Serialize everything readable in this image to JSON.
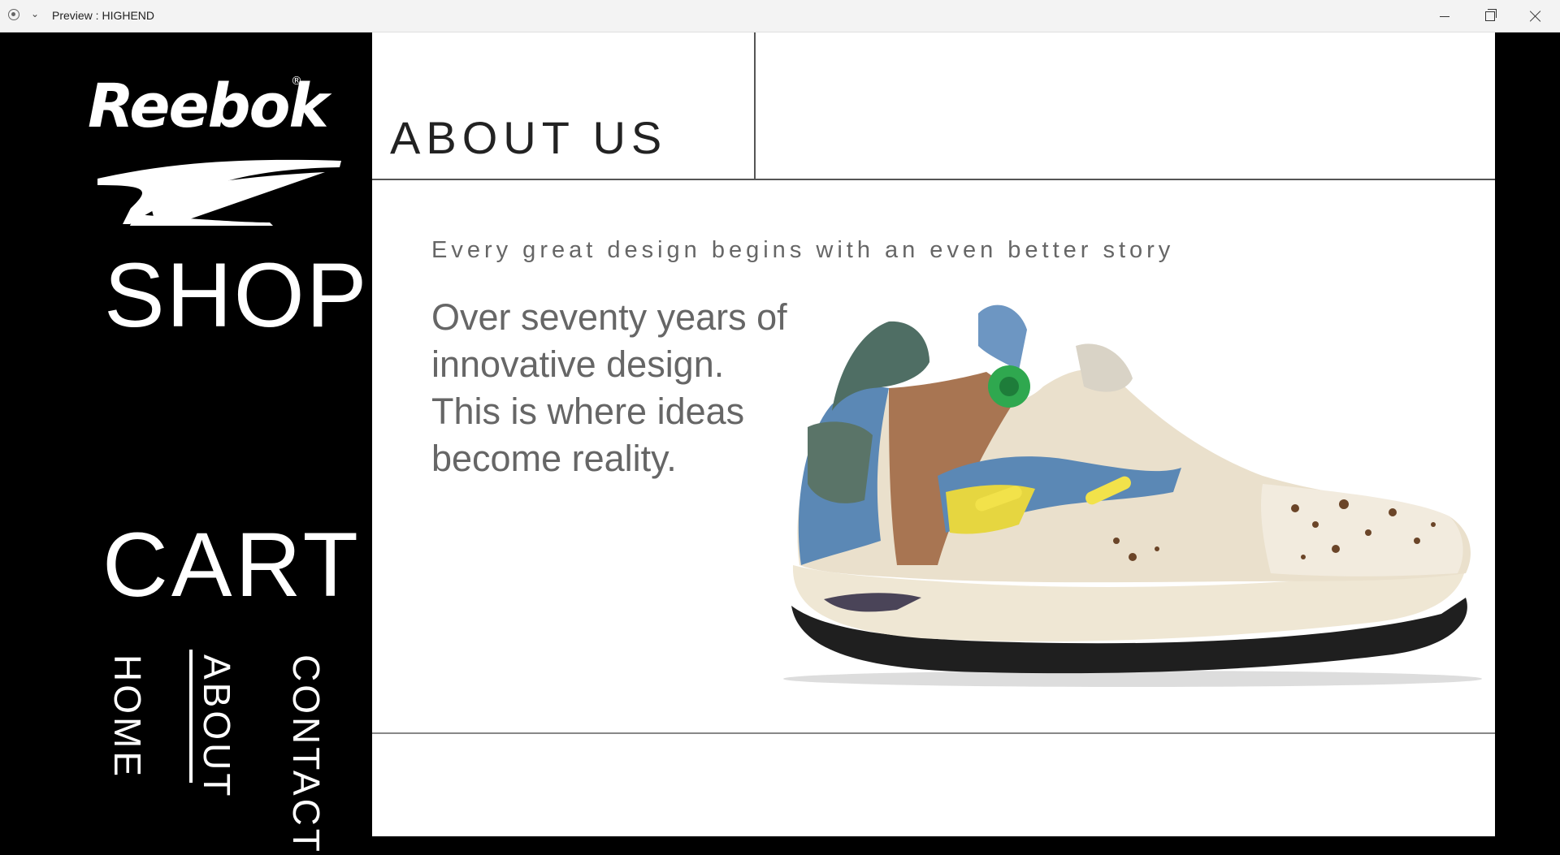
{
  "window": {
    "title": "Preview : HIGHEND"
  },
  "sidebar": {
    "logo_text": "Reebok",
    "logo_reg": "®",
    "shop_label": "SHOP",
    "cart_label": "CART",
    "nav": {
      "home": "HOME",
      "about": "ABOUT",
      "contact": "CONTACT"
    },
    "active_item": "ABOUT"
  },
  "main": {
    "page_title": "ABOUT US",
    "tagline": "Every great design begins with an even better story",
    "body_lines": [
      "Over seventy years of",
      "innovative design.",
      "This is where ideas",
      "become reality."
    ],
    "image_alt": "sneaker"
  },
  "colors": {
    "sidebar_bg": "#000000",
    "main_bg": "#ffffff",
    "text_gray": "#666666"
  }
}
